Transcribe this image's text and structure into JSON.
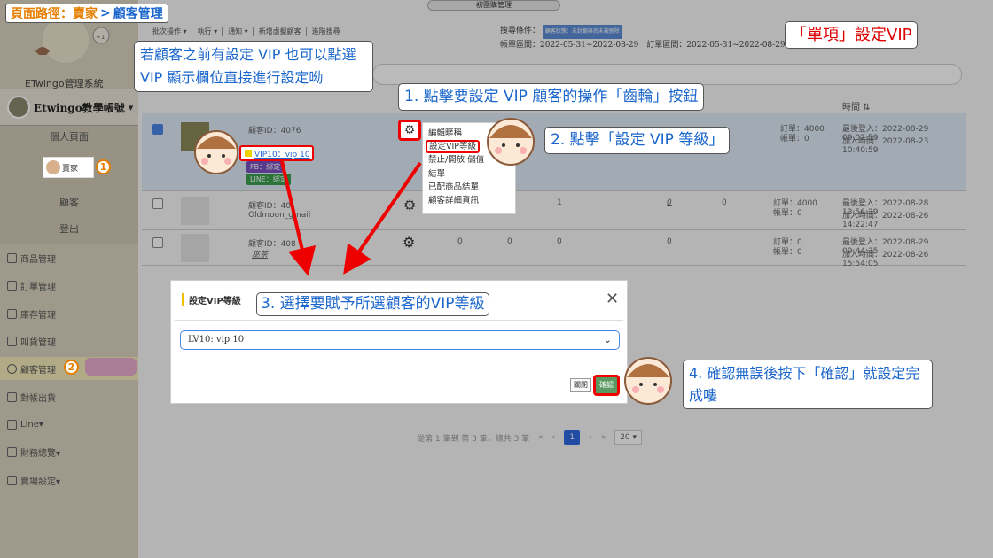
{
  "breadcrumb": {
    "prefix": "頁面路徑：賣家",
    "separator": ">",
    "current": "顧客管理"
  },
  "store_select": "初團購管理",
  "sidebar": {
    "system_name": "ETwingo管理系統",
    "user_name": "Etwingo教學帳號",
    "user_caret": "▾",
    "submenu": [
      "個人頁面",
      "顧客",
      "登出"
    ],
    "seller_tip": "賣家",
    "nav": [
      {
        "label": "商品管理"
      },
      {
        "label": "訂單管理"
      },
      {
        "label": "庫存管理"
      },
      {
        "label": "叫貨管理"
      },
      {
        "label": "顧客管理"
      },
      {
        "label": "對帳出貨"
      },
      {
        "label": "Line▾"
      },
      {
        "label": "財務總覽▾"
      },
      {
        "label": "賣場設定▾"
      }
    ]
  },
  "toolbar": [
    "批次操作 ▾",
    "執行 ▾",
    "通知 ▾",
    "新增虛擬顧客",
    "進階搜尋"
  ],
  "search_info": {
    "conditions_label": "搜尋條件：",
    "conditions_badge": "顧客狀態：未封鎖與尚未被刪除",
    "range": "帳單區間：2022-05-31~2022-08-29　訂單區間：2022-05-31~2022-08-29"
  },
  "table": {
    "time_header": "時間 ⇅",
    "rows": [
      {
        "id": "顧客ID：4076",
        "vip": "VIP10：vip 10",
        "fb": "FB：綁定",
        "line": "LINE：綁定",
        "orders": "訂單：4000",
        "bills": "帳單：0",
        "last_login": "最後登入：2022-08-29 09:02:59",
        "joined": "加入時間：2022-08-23 10:40:59"
      },
      {
        "id": "顧客ID：40",
        "name": "Oldmoon_gmail",
        "cols": [
          "0",
          "1",
          "0",
          "0"
        ],
        "orders": "訂單：4000",
        "bills": "帳單：0",
        "last_login": "最後登入：2022-08-28 13:56:39",
        "joined": "加入時間：2022-08-26 14:22:47"
      },
      {
        "id": "顧客ID：408",
        "name": "巫茶",
        "cols": [
          "0",
          "0",
          "0",
          "0"
        ],
        "orders": "訂單：0",
        "bills": "帳單：0",
        "last_login": "最後登入：2022-08-29 09:44:35",
        "joined": "加入時間：2022-08-26 15:54:05"
      }
    ]
  },
  "context_menu": [
    "編輯暱稱",
    "設定VIP等級",
    "禁止/開放 儲值",
    "結單",
    "已配商品結單",
    "顧客詳細資訊"
  ],
  "modal": {
    "title": "設定VIP等級",
    "close": "✕",
    "selected": "LV10: vip 10",
    "btn_close": "關閉",
    "btn_confirm": "確認"
  },
  "pager": {
    "summary": "從第 1 筆到 第 3 筆，總共 3 筆",
    "first": "«",
    "prev": "‹",
    "page": "1",
    "next": "›",
    "last": "»",
    "page_size": "20 ▾"
  },
  "callouts": {
    "title": "「單項」設定VIP",
    "tip0": "若顧客之前有設定 VIP 也可以點選 VIP 顯示欄位直接進行設定呦",
    "step1": "1. 點擊要設定 VIP 顧客的操作「齒輪」按鈕",
    "step2": "2. 點擊「設定 VIP 等級」",
    "step3": "3. 選擇要賦予所選顧客的VIP等級",
    "step4": "4. 確認無誤後按下「確認」就設定完成嘍",
    "num1": "1",
    "num2": "2"
  },
  "colors": {
    "accent_red": "#e00000",
    "callout_blue": "#1a66cc",
    "breadcrumb_orange": "#e67e00"
  }
}
